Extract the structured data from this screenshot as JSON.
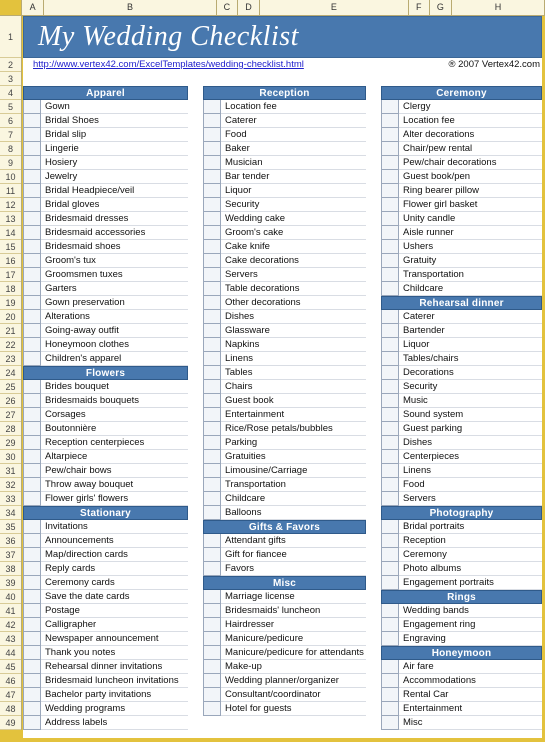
{
  "window": {
    "banner_title": "My Wedding Checklist",
    "url": "http://www.vertex42.com/ExcelTemplates/wedding-checklist.html",
    "copyright": "® 2007 Vertex42.com",
    "accent_blue": "#4878AE",
    "frame_gold": "#e3c23d",
    "header_beige": "#faf6e0"
  },
  "column_headers": [
    "A",
    "B",
    "C",
    "D",
    "E",
    "F",
    "G",
    "H"
  ],
  "row_numbers": [
    1,
    2,
    3,
    4,
    5,
    6,
    7,
    8,
    9,
    10,
    11,
    12,
    13,
    14,
    15,
    16,
    17,
    18,
    19,
    20,
    21,
    22,
    23,
    24,
    25,
    26,
    27,
    28,
    29,
    30,
    31,
    32,
    33,
    34,
    35,
    36,
    37,
    38,
    39,
    40,
    41,
    42,
    43,
    44,
    45,
    46,
    47,
    48,
    49
  ],
  "columns": [
    {
      "id": "column-one",
      "rows": [
        {
          "type": "header",
          "label": "Apparel"
        },
        {
          "type": "item",
          "label": "Gown"
        },
        {
          "type": "item",
          "label": "Bridal Shoes"
        },
        {
          "type": "item",
          "label": "Bridal slip"
        },
        {
          "type": "item",
          "label": "Lingerie"
        },
        {
          "type": "item",
          "label": "Hosiery"
        },
        {
          "type": "item",
          "label": "Jewelry"
        },
        {
          "type": "item",
          "label": "Bridal Headpiece/veil"
        },
        {
          "type": "item",
          "label": "Bridal gloves"
        },
        {
          "type": "item",
          "label": "Bridesmaid dresses"
        },
        {
          "type": "item",
          "label": "Bridesmaid accessories"
        },
        {
          "type": "item",
          "label": "Bridesmaid shoes"
        },
        {
          "type": "item",
          "label": "Groom's tux"
        },
        {
          "type": "item",
          "label": "Groomsmen tuxes"
        },
        {
          "type": "item",
          "label": "Garters"
        },
        {
          "type": "item",
          "label": "Gown preservation"
        },
        {
          "type": "item",
          "label": "Alterations"
        },
        {
          "type": "item",
          "label": "Going-away outfit"
        },
        {
          "type": "item",
          "label": "Honeymoon clothes"
        },
        {
          "type": "item",
          "label": "Children's apparel"
        },
        {
          "type": "header",
          "label": "Flowers"
        },
        {
          "type": "item",
          "label": "Brides bouquet"
        },
        {
          "type": "item",
          "label": "Bridesmaids bouquets"
        },
        {
          "type": "item",
          "label": "Corsages"
        },
        {
          "type": "item",
          "label": "Boutonnière"
        },
        {
          "type": "item",
          "label": "Reception centerpieces"
        },
        {
          "type": "item",
          "label": "Altarpiece"
        },
        {
          "type": "item",
          "label": "Pew/chair bows"
        },
        {
          "type": "item",
          "label": "Throw away bouquet"
        },
        {
          "type": "item",
          "label": "Flower girls' flowers"
        },
        {
          "type": "header",
          "label": "Stationary"
        },
        {
          "type": "item",
          "label": "Invitations"
        },
        {
          "type": "item",
          "label": "Announcements"
        },
        {
          "type": "item",
          "label": "Map/direction cards"
        },
        {
          "type": "item",
          "label": "Reply cards"
        },
        {
          "type": "item",
          "label": "Ceremony cards"
        },
        {
          "type": "item",
          "label": "Save the date cards"
        },
        {
          "type": "item",
          "label": "Postage"
        },
        {
          "type": "item",
          "label": "Calligrapher"
        },
        {
          "type": "item",
          "label": "Newspaper announcement"
        },
        {
          "type": "item",
          "label": "Thank you notes"
        },
        {
          "type": "item",
          "label": "Rehearsal dinner invitations"
        },
        {
          "type": "item",
          "label": "Bridesmaid luncheon invitations"
        },
        {
          "type": "item",
          "label": "Bachelor party invitations"
        },
        {
          "type": "item",
          "label": "Wedding programs"
        },
        {
          "type": "item",
          "label": "Address labels"
        }
      ]
    },
    {
      "id": "column-two",
      "rows": [
        {
          "type": "header",
          "label": "Reception"
        },
        {
          "type": "item",
          "label": "Location fee"
        },
        {
          "type": "item",
          "label": "Caterer"
        },
        {
          "type": "item",
          "label": "Food"
        },
        {
          "type": "item",
          "label": "Baker"
        },
        {
          "type": "item",
          "label": "Musician"
        },
        {
          "type": "item",
          "label": "Bar tender"
        },
        {
          "type": "item",
          "label": "Liquor"
        },
        {
          "type": "item",
          "label": "Security"
        },
        {
          "type": "item",
          "label": "Wedding cake"
        },
        {
          "type": "item",
          "label": "Groom's cake"
        },
        {
          "type": "item",
          "label": "Cake knife"
        },
        {
          "type": "item",
          "label": "Cake decorations"
        },
        {
          "type": "item",
          "label": "Servers"
        },
        {
          "type": "item",
          "label": "Table decorations"
        },
        {
          "type": "item",
          "label": "Other decorations"
        },
        {
          "type": "item",
          "label": "Dishes"
        },
        {
          "type": "item",
          "label": "Glassware"
        },
        {
          "type": "item",
          "label": "Napkins"
        },
        {
          "type": "item",
          "label": "Linens"
        },
        {
          "type": "item",
          "label": "Tables"
        },
        {
          "type": "item",
          "label": "Chairs"
        },
        {
          "type": "item",
          "label": "Guest book"
        },
        {
          "type": "item",
          "label": "Entertainment"
        },
        {
          "type": "item",
          "label": "Rice/Rose petals/bubbles"
        },
        {
          "type": "item",
          "label": "Parking"
        },
        {
          "type": "item",
          "label": "Gratuities"
        },
        {
          "type": "item",
          "label": "Limousine/Carriage"
        },
        {
          "type": "item",
          "label": "Transportation"
        },
        {
          "type": "item",
          "label": "Childcare"
        },
        {
          "type": "item",
          "label": "Balloons"
        },
        {
          "type": "header",
          "label": "Gifts & Favors"
        },
        {
          "type": "item",
          "label": "Attendant gifts"
        },
        {
          "type": "item",
          "label": "Gift for fiancee"
        },
        {
          "type": "item",
          "label": "Favors"
        },
        {
          "type": "header",
          "label": "Misc"
        },
        {
          "type": "item",
          "label": "Marriage license"
        },
        {
          "type": "item",
          "label": "Bridesmaids' luncheon"
        },
        {
          "type": "item",
          "label": "Hairdresser"
        },
        {
          "type": "item",
          "label": "Manicure/pedicure"
        },
        {
          "type": "item",
          "label": "Manicure/pedicure for attendants"
        },
        {
          "type": "item",
          "label": "Make-up"
        },
        {
          "type": "item",
          "label": "Wedding planner/organizer"
        },
        {
          "type": "item",
          "label": "Consultant/coordinator"
        },
        {
          "type": "item",
          "label": "Hotel for guests"
        }
      ]
    },
    {
      "id": "column-three",
      "rows": [
        {
          "type": "header",
          "label": "Ceremony"
        },
        {
          "type": "item",
          "label": "Clergy"
        },
        {
          "type": "item",
          "label": "Location fee"
        },
        {
          "type": "item",
          "label": "Alter decorations"
        },
        {
          "type": "item",
          "label": "Chair/pew rental"
        },
        {
          "type": "item",
          "label": "Pew/chair decorations"
        },
        {
          "type": "item",
          "label": "Guest book/pen"
        },
        {
          "type": "item",
          "label": "Ring bearer pillow"
        },
        {
          "type": "item",
          "label": "Flower girl basket"
        },
        {
          "type": "item",
          "label": "Unity candle"
        },
        {
          "type": "item",
          "label": "Aisle runner"
        },
        {
          "type": "item",
          "label": "Ushers"
        },
        {
          "type": "item",
          "label": "Gratuity"
        },
        {
          "type": "item",
          "label": "Transportation"
        },
        {
          "type": "item",
          "label": "Childcare"
        },
        {
          "type": "header",
          "label": "Rehearsal dinner"
        },
        {
          "type": "item",
          "label": "Caterer"
        },
        {
          "type": "item",
          "label": "Bartender"
        },
        {
          "type": "item",
          "label": "Liquor"
        },
        {
          "type": "item",
          "label": "Tables/chairs"
        },
        {
          "type": "item",
          "label": "Decorations"
        },
        {
          "type": "item",
          "label": "Security"
        },
        {
          "type": "item",
          "label": "Music"
        },
        {
          "type": "item",
          "label": "Sound system"
        },
        {
          "type": "item",
          "label": "Guest parking"
        },
        {
          "type": "item",
          "label": "Dishes"
        },
        {
          "type": "item",
          "label": "Centerpieces"
        },
        {
          "type": "item",
          "label": "Linens"
        },
        {
          "type": "item",
          "label": "Food"
        },
        {
          "type": "item",
          "label": "Servers"
        },
        {
          "type": "header",
          "label": "Photography"
        },
        {
          "type": "item",
          "label": "Bridal portraits"
        },
        {
          "type": "item",
          "label": "Reception"
        },
        {
          "type": "item",
          "label": "Ceremony"
        },
        {
          "type": "item",
          "label": "Photo albums"
        },
        {
          "type": "item",
          "label": "Engagement portraits"
        },
        {
          "type": "header",
          "label": "Rings"
        },
        {
          "type": "item",
          "label": "Wedding bands"
        },
        {
          "type": "item",
          "label": "Engagement ring"
        },
        {
          "type": "item",
          "label": "Engraving"
        },
        {
          "type": "header",
          "label": "Honeymoon"
        },
        {
          "type": "item",
          "label": "Air fare"
        },
        {
          "type": "item",
          "label": "Accommodations"
        },
        {
          "type": "item",
          "label": "Rental Car"
        },
        {
          "type": "item",
          "label": "Entertainment"
        },
        {
          "type": "item",
          "label": "Misc"
        }
      ]
    }
  ]
}
